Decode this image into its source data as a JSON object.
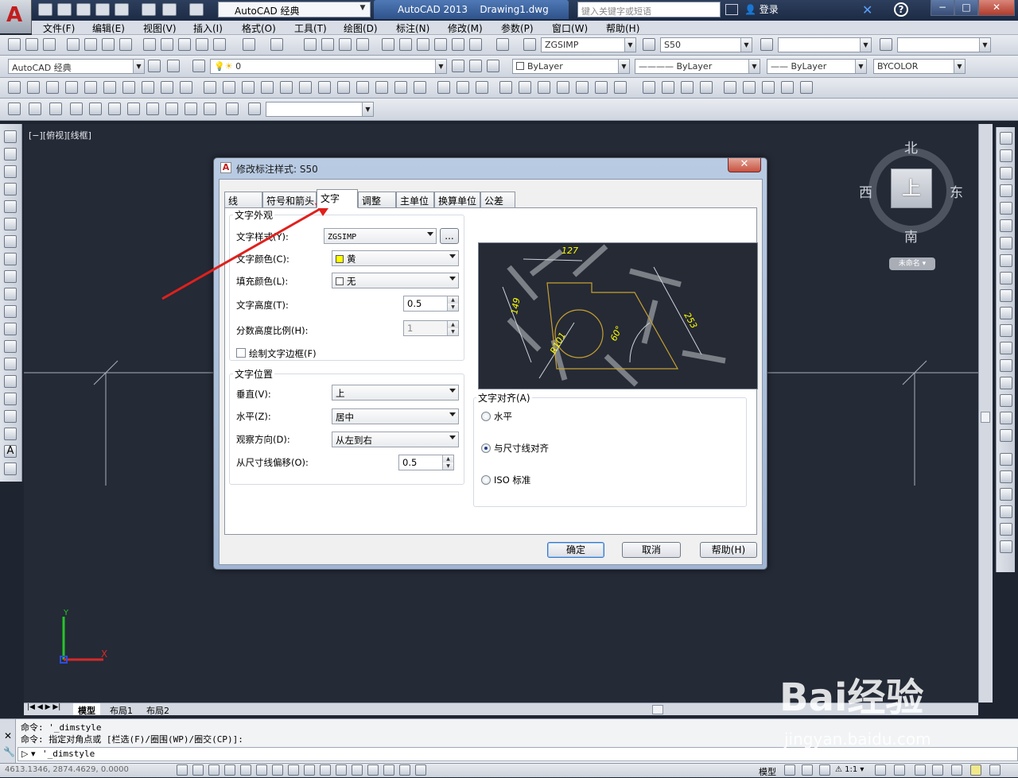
{
  "window": {
    "title_app": "AutoCAD 2013",
    "title_doc": "Drawing1.dwg",
    "workspace": "AutoCAD 经典",
    "search_placeholder": "键入关键字或短语",
    "login": "登录"
  },
  "menu": [
    "文件(F)",
    "编辑(E)",
    "视图(V)",
    "插入(I)",
    "格式(O)",
    "工具(T)",
    "绘图(D)",
    "标注(N)",
    "修改(M)",
    "参数(P)",
    "窗口(W)",
    "帮助(H)"
  ],
  "toolbar": {
    "text_style": "ZGSIMP",
    "dim_style": "S50",
    "workspace2": "AutoCAD 经典",
    "layer": "0",
    "color": "ByLayer",
    "linetype": "ByLayer",
    "lineweight": "ByLayer",
    "plotstyle": "BYCOLOR"
  },
  "viewport": {
    "label": "[−][俯视][线框]",
    "viewcube": {
      "north": "北",
      "south": "南",
      "east": "东",
      "west": "西",
      "top": "上",
      "unnamed": "未命名"
    }
  },
  "layout_tabs": [
    "模型",
    "布局1",
    "布局2"
  ],
  "command": {
    "line1": "命令: '_dimstyle",
    "line2": "命令: 指定对角点或 [栏选(F)/圈围(WP)/圈交(CP)]:",
    "input": "'_dimstyle"
  },
  "status": {
    "coords": "4613.1346, 2874.4629, 0.0000",
    "model": "模型",
    "scale": "1:1"
  },
  "dialog": {
    "title": "修改标注样式: S50",
    "tabs": [
      "线",
      "符号和箭头",
      "文字",
      "调整",
      "主单位",
      "换算单位",
      "公差"
    ],
    "active_tab": "文字",
    "appearance": {
      "group": "文字外观",
      "style_label": "文字样式(Y):",
      "style_value": "ZGSIMP",
      "style_btn": "...",
      "color_label": "文字颜色(C):",
      "color_value": "黄",
      "fill_label": "填充颜色(L):",
      "fill_value": "无",
      "height_label": "文字高度(T):",
      "height_value": "0.5",
      "fraction_label": "分数高度比例(H):",
      "fraction_value": "1",
      "frame_label": "绘制文字边框(F)"
    },
    "placement": {
      "group": "文字位置",
      "vertical_label": "垂直(V):",
      "vertical_value": "上",
      "horizontal_label": "水平(Z):",
      "horizontal_value": "居中",
      "direction_label": "观察方向(D):",
      "direction_value": "从左到右",
      "offset_label": "从尺寸线偏移(O):",
      "offset_value": "0.5"
    },
    "alignment": {
      "group": "文字对齐(A)",
      "options": [
        "水平",
        "与尺寸线对齐",
        "ISO 标准"
      ],
      "selected": 1
    },
    "preview_labels": [
      "127",
      "149",
      "253",
      "R101",
      "60°"
    ],
    "buttons": {
      "ok": "确定",
      "cancel": "取消",
      "help": "帮助(H)"
    },
    "colors": {
      "text": "#ffff00",
      "preview_bg": "#252a35",
      "geometry": "#c8a030"
    }
  },
  "watermark": {
    "brand": "Bai经验",
    "url": "jingyan.baidu.com"
  }
}
